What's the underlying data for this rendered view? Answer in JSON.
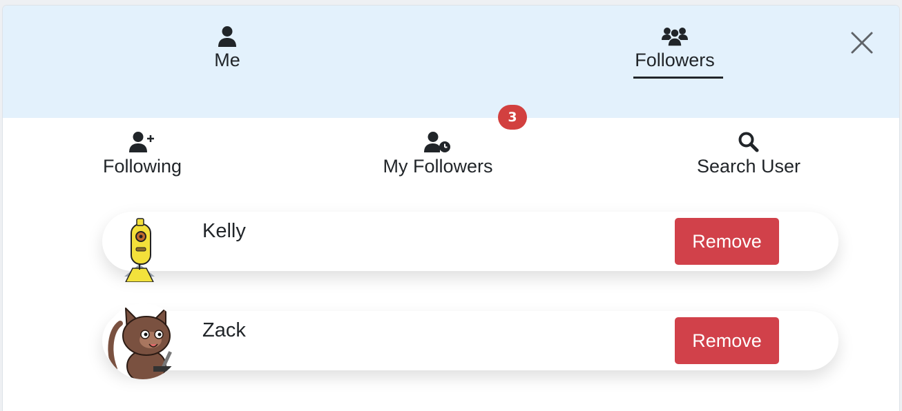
{
  "top_tabs": [
    {
      "label": "Me",
      "icon": "user-icon",
      "active": false
    },
    {
      "label": "Followers",
      "icon": "users-icon",
      "active": true
    }
  ],
  "sub_tabs": [
    {
      "label": "Following",
      "icon": "user-plus-icon"
    },
    {
      "label": "My Followers",
      "icon": "user-clock-icon",
      "badge": "3"
    },
    {
      "label": "Search User",
      "icon": "search-icon"
    }
  ],
  "followers": [
    {
      "name": "Kelly",
      "action": "Remove",
      "avatar": "yellow-robot-avatar"
    },
    {
      "name": "Zack",
      "action": "Remove",
      "avatar": "brown-cat-avatar"
    }
  ],
  "colors": {
    "top_bar": "#e3f1fc",
    "remove_button": "#d1414a",
    "badge": "#d2403f",
    "text": "#212529"
  }
}
